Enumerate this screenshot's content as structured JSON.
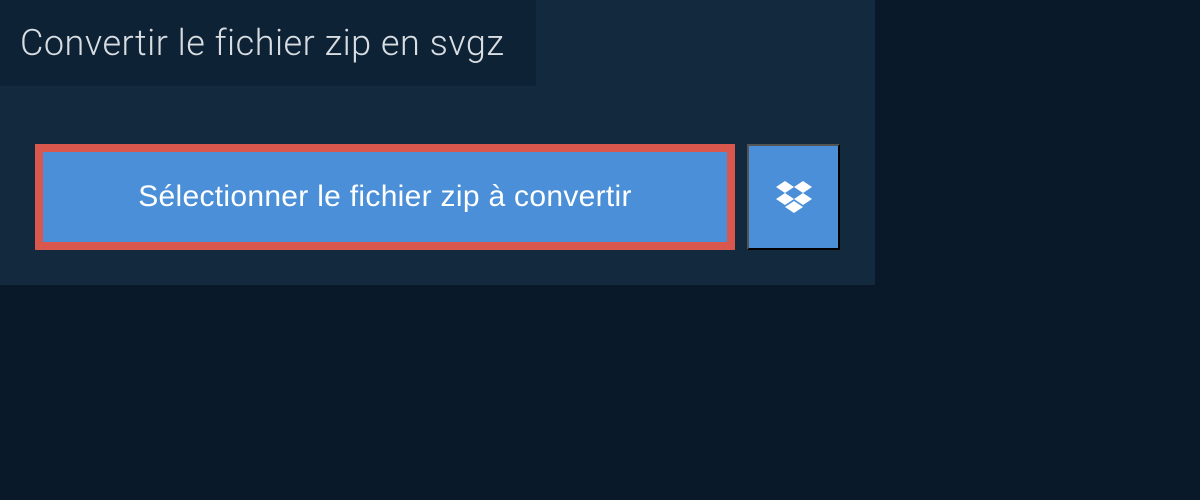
{
  "header": {
    "title": "Convertir le fichier zip en svgz"
  },
  "actions": {
    "select_file_label": "Sélectionner le fichier zip à convertir",
    "dropbox_icon": "dropbox-icon"
  },
  "colors": {
    "background_dark": "#0a1929",
    "panel": "#13293d",
    "title_bar": "#0e2235",
    "button_blue": "#4a8fd8",
    "button_border": "#d9574c",
    "text_light": "#d8dde2"
  }
}
